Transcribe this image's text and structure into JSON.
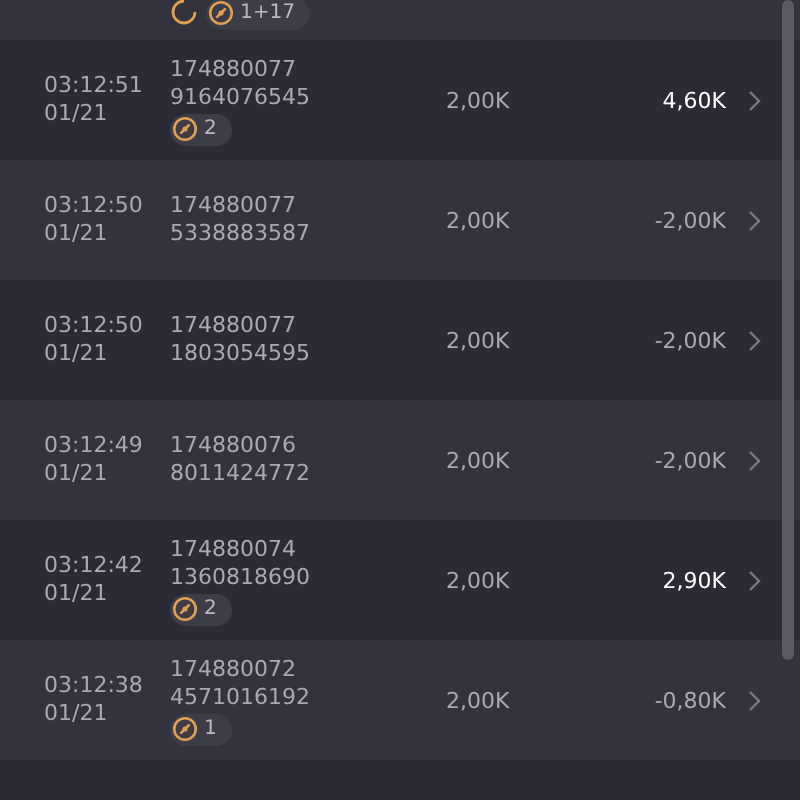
{
  "top_row": {
    "badge": "1+17",
    "pending": true
  },
  "rows": [
    {
      "time": "03:12:51",
      "date": "01/21",
      "id_1": "174880077",
      "id_2": "9164076545",
      "badge": "2",
      "amount": "2,00K",
      "result": "4,60K",
      "highlighted": true
    },
    {
      "time": "03:12:50",
      "date": "01/21",
      "id_1": "174880077",
      "id_2": "5338883587",
      "amount": "2,00K",
      "result": "-2,00K",
      "highlighted": false
    },
    {
      "time": "03:12:50",
      "date": "01/21",
      "id_1": "174880077",
      "id_2": "1803054595",
      "amount": "2,00K",
      "result": "-2,00K",
      "highlighted": false
    },
    {
      "time": "03:12:49",
      "date": "01/21",
      "id_1": "174880076",
      "id_2": "8011424772",
      "amount": "2,00K",
      "result": "-2,00K",
      "highlighted": false
    },
    {
      "time": "03:12:42",
      "date": "01/21",
      "id_1": "174880074",
      "id_2": "1360818690",
      "badge": "2",
      "amount": "2,00K",
      "result": "2,90K",
      "highlighted": true
    },
    {
      "time": "03:12:38",
      "date": "01/21",
      "id_1": "174880072",
      "id_2": "4571016192",
      "badge": "1",
      "amount": "2,00K",
      "result": "-0,80K",
      "highlighted": false
    }
  ]
}
